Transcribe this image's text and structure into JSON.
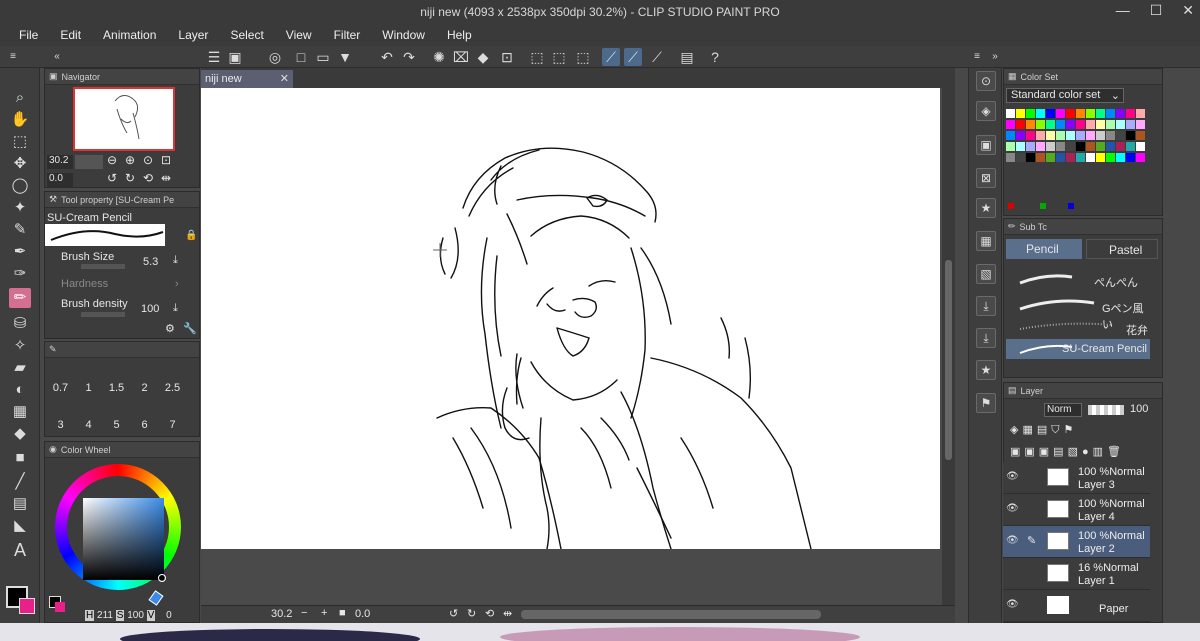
{
  "window": {
    "title": "niji new (4093 x 2538px 350dpi 30.2%) - CLIP STUDIO PAINT PRO"
  },
  "menu": [
    "File",
    "Edit",
    "Animation",
    "Layer",
    "Select",
    "View",
    "Filter",
    "Window",
    "Help"
  ],
  "navigator": {
    "title": "Navigator",
    "zoom": "30.2",
    "angle": "0.0"
  },
  "tool_property": {
    "title": "Tool property [SU-Cream Pe",
    "brush_name": "SU-Cream Pencil",
    "brush_size_label": "Brush Size",
    "brush_size_value": "5.3",
    "hardness_label": "Hardness",
    "density_label": "Brush density",
    "density_value": "100"
  },
  "brush_sizes": {
    "row1": [
      "0.7",
      "1",
      "1.5",
      "2",
      "2.5"
    ],
    "row2": [
      "3",
      "4",
      "5",
      "6",
      "7"
    ]
  },
  "color_wheel": {
    "title": "Color Wheel",
    "readout_h": "H",
    "h": "211",
    "readout_s": "S",
    "s": "100",
    "readout_v": "V",
    "v": "0",
    "main_color": "#000000",
    "sub_color": "#e8218a",
    "hue_color": "#3a8be8"
  },
  "canvas": {
    "tab_label": "niji new",
    "zoom": "30.2",
    "angle": "0.0"
  },
  "color_set": {
    "title": "Color Set",
    "dropdown": "Standard color set"
  },
  "sub_tool": {
    "title": "Sub Tc",
    "tabs": [
      "Pencil",
      "Pastel"
    ],
    "brushes": [
      "ぺんぺん",
      "Gペン風い",
      "花弁",
      "SU-Cream Pencil"
    ]
  },
  "layer_panel": {
    "title": "Layer",
    "blend": "Norm",
    "opacity": "100",
    "layers": [
      {
        "pct": "100 %",
        "mode": "Normal",
        "name": "Layer 3"
      },
      {
        "pct": "100 %",
        "mode": "Normal",
        "name": "Layer 4"
      },
      {
        "pct": "100 %",
        "mode": "Normal",
        "name": "Layer 2"
      },
      {
        "pct": "16 %",
        "mode": "Normal",
        "name": "Layer 1"
      },
      {
        "pct": "",
        "mode": "",
        "name": "Paper"
      }
    ]
  },
  "icons": [
    "search-icon",
    "hand-icon",
    "move-icon",
    "lasso-icon",
    "eyedropper-icon",
    "pen-icon",
    "pencil-icon",
    "brush-icon",
    "eraser-icon",
    "fill-icon",
    "text-icon",
    "undo-icon",
    "redo-icon"
  ]
}
